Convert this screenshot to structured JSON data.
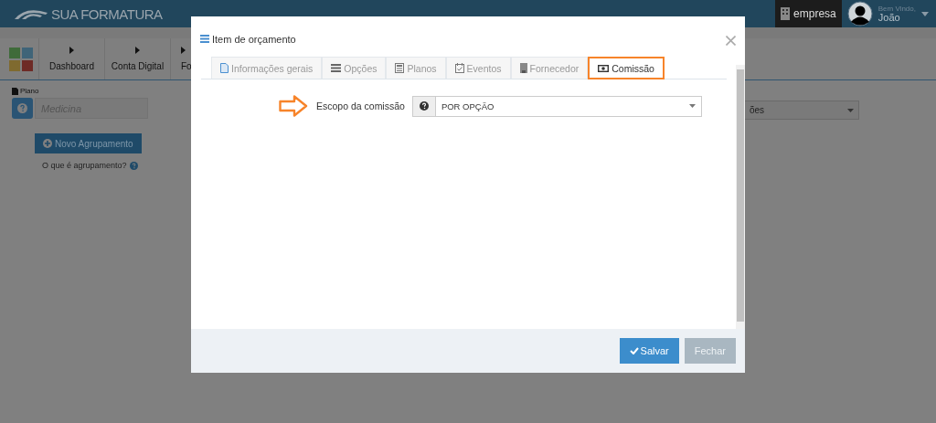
{
  "header": {
    "logo": "SUA FORMATURA",
    "company": "empresa",
    "greeting": "Bem Vindo,",
    "user": "João"
  },
  "nav": [
    {
      "label": "Dashboard"
    },
    {
      "label": "Conta Digital"
    },
    {
      "label": "Fo"
    }
  ],
  "plan": {
    "label": "Plano",
    "placeholder": "Medicina",
    "button": "Novo Agrupamento",
    "help_link": "O que é agrupamento?"
  },
  "right_select": {
    "value": "ões"
  },
  "modal": {
    "title": "Item de orçamento",
    "tabs": [
      {
        "label": "Informações gerais",
        "selected": false
      },
      {
        "label": "Opções",
        "selected": false
      },
      {
        "label": "Planos",
        "selected": false
      },
      {
        "label": "Eventos",
        "selected": false
      },
      {
        "label": "Fornecedor",
        "selected": false
      },
      {
        "label": "Comissão",
        "selected": true
      }
    ],
    "field": {
      "label": "Escopo da comissão",
      "value": "POR OPÇÃO"
    },
    "buttons": [
      {
        "label": "Salvar",
        "kind": "primary"
      },
      {
        "label": "Fechar",
        "kind": "secondary"
      }
    ]
  }
}
